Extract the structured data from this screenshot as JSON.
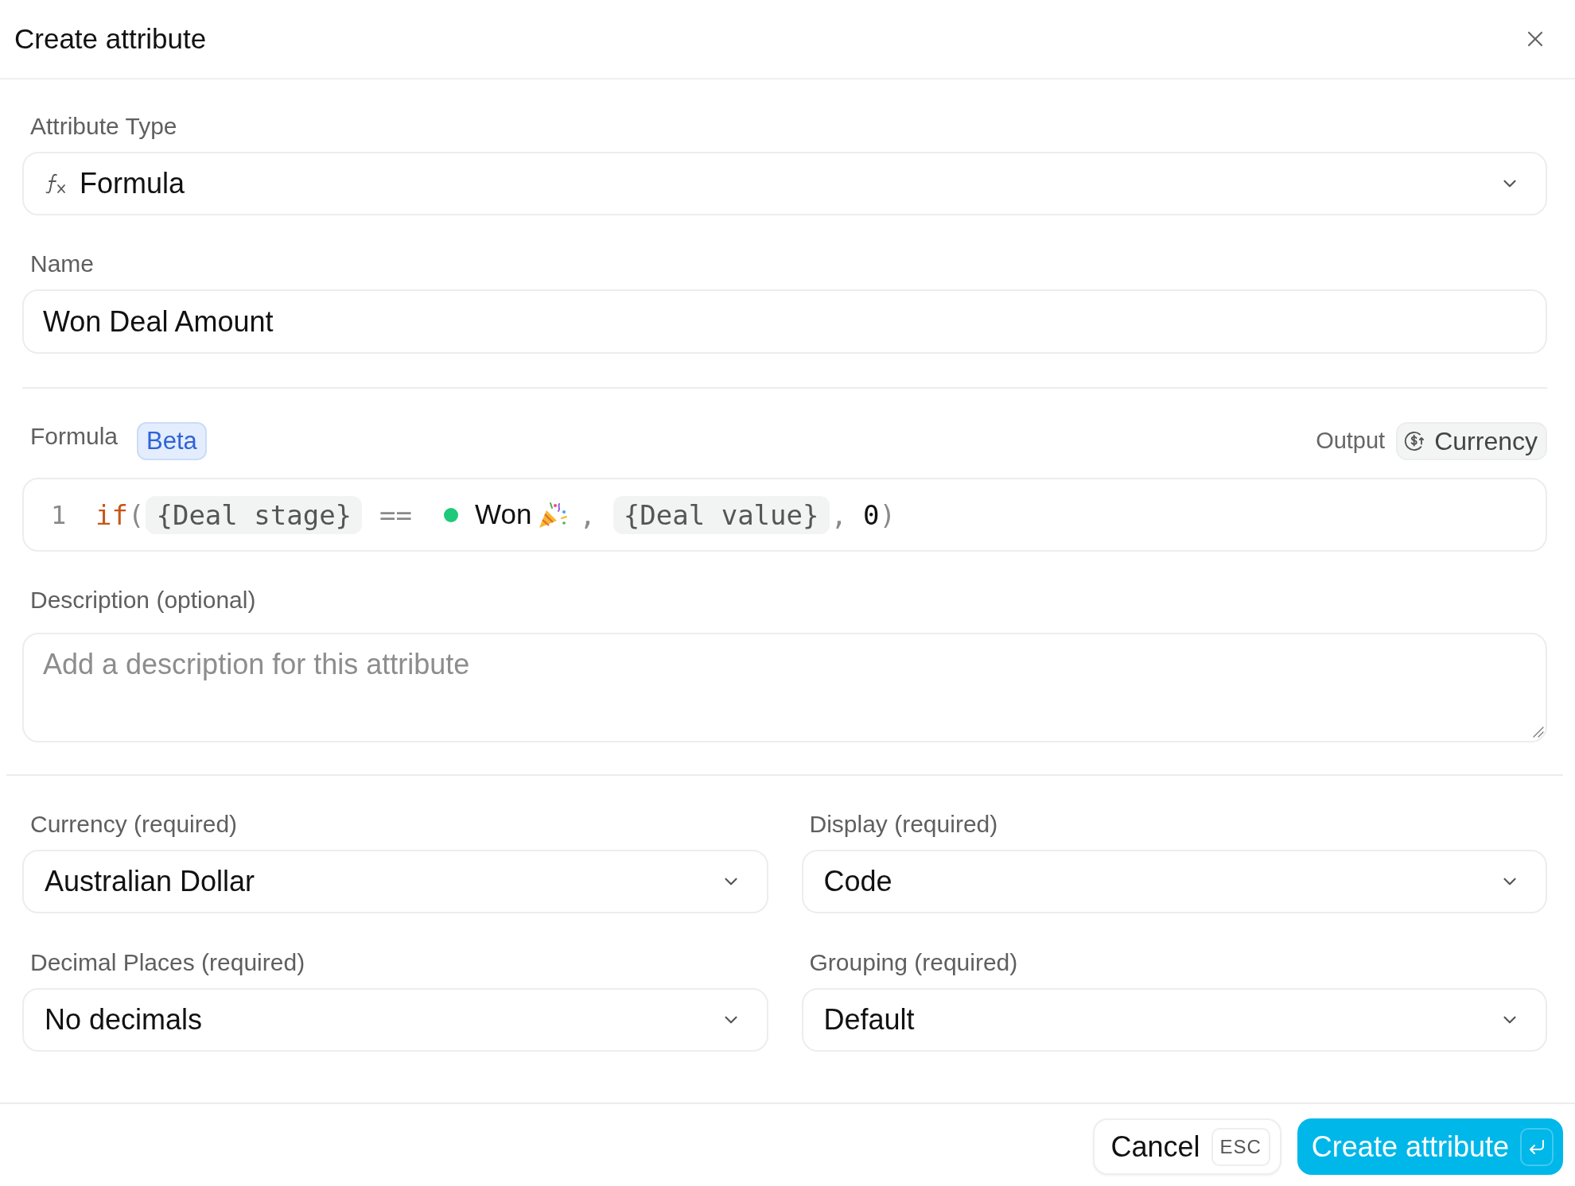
{
  "dialog": {
    "title": "Create attribute"
  },
  "attribute_type": {
    "label": "Attribute Type",
    "value": "Formula"
  },
  "name": {
    "label": "Name",
    "value": "Won Deal Amount"
  },
  "formula": {
    "label": "Formula",
    "badge": "Beta",
    "output_label": "Output",
    "output_type": "Currency",
    "lines": [
      {
        "number": "1",
        "tokens": [
          {
            "kind": "keyword",
            "text": "if"
          },
          {
            "kind": "punctuation",
            "text": "("
          },
          {
            "kind": "reference",
            "text": "{Deal stage}"
          },
          {
            "kind": "space"
          },
          {
            "kind": "operator",
            "text": "=="
          },
          {
            "kind": "space"
          },
          {
            "kind": "status",
            "text": "Won",
            "color": "#1ec97a"
          },
          {
            "kind": "emoji"
          },
          {
            "kind": "punctuation",
            "text": ","
          },
          {
            "kind": "space"
          },
          {
            "kind": "reference",
            "text": "{Deal value}"
          },
          {
            "kind": "punctuation",
            "text": ","
          },
          {
            "kind": "space"
          },
          {
            "kind": "number",
            "text": "0"
          },
          {
            "kind": "punctuation",
            "text": ")"
          }
        ]
      }
    ]
  },
  "description": {
    "label": "Description (optional)",
    "placeholder": "Add a description for this attribute"
  },
  "settings": [
    {
      "label": "Currency (required)",
      "value": "Australian Dollar"
    },
    {
      "label": "Display (required)",
      "value": "Code"
    },
    {
      "label": "Decimal Places (required)",
      "value": "No decimals"
    },
    {
      "label": "Grouping (required)",
      "value": "Default"
    }
  ],
  "footer": {
    "buttons": [
      {
        "kind": "secondary",
        "label": "Cancel",
        "shortcut": "ESC"
      },
      {
        "kind": "primary",
        "label": "Create attribute"
      }
    ]
  }
}
